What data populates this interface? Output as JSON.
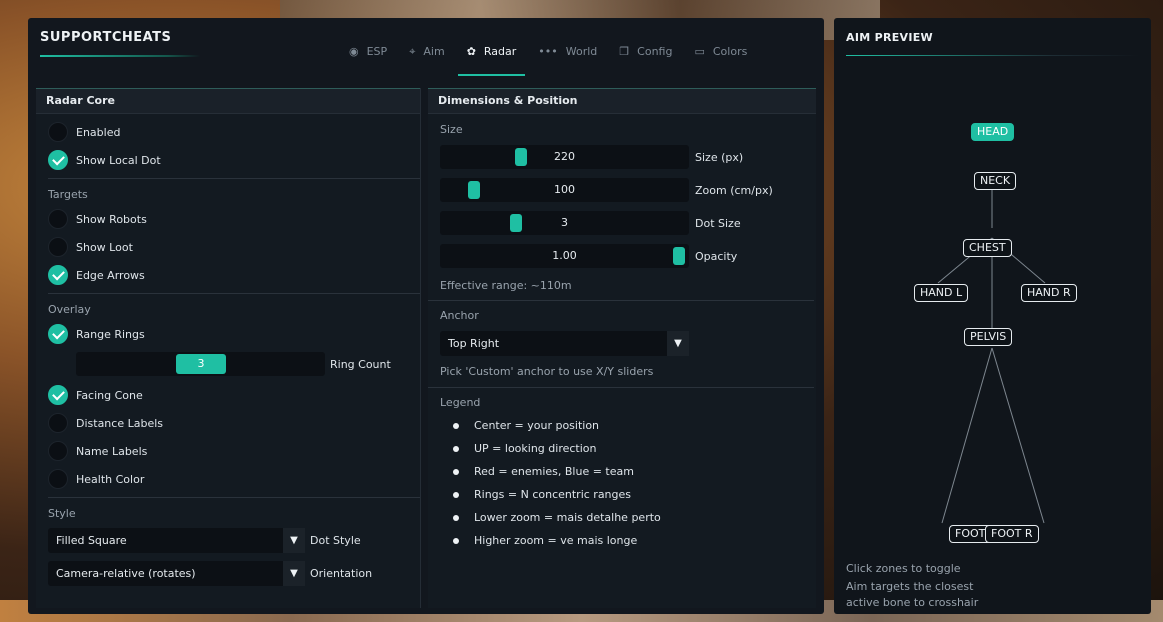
{
  "app": {
    "brand": "SUPPORTCHEATS"
  },
  "tabs": [
    {
      "icon": "eye-icon",
      "glyph": "◉",
      "label": "ESP",
      "active": false
    },
    {
      "icon": "crosshair-icon",
      "glyph": "⌖",
      "label": "Aim",
      "active": false
    },
    {
      "icon": "gear-icon",
      "glyph": "✿",
      "label": "Radar",
      "active": true
    },
    {
      "icon": "dots-icon",
      "glyph": "•••",
      "label": "World",
      "active": false
    },
    {
      "icon": "config-icon",
      "glyph": "❐",
      "label": "Config",
      "active": false
    },
    {
      "icon": "folder-icon",
      "glyph": "▭",
      "label": "Colors",
      "active": false
    }
  ],
  "left": {
    "title": "Radar Core",
    "enabled": {
      "label": "Enabled",
      "checked": false
    },
    "show_local_dot": {
      "label": "Show Local Dot",
      "checked": true
    },
    "targets_label": "Targets",
    "show_robots": {
      "label": "Show Robots",
      "checked": false
    },
    "show_loot": {
      "label": "Show Loot",
      "checked": false
    },
    "edge_arrows": {
      "label": "Edge Arrows",
      "checked": true
    },
    "overlay_label": "Overlay",
    "range_rings": {
      "label": "Range Rings",
      "checked": true
    },
    "ring_count": {
      "value": "3",
      "label": "Ring Count",
      "fraction": 0.5
    },
    "facing_cone": {
      "label": "Facing Cone",
      "checked": true
    },
    "distance_labels": {
      "label": "Distance Labels",
      "checked": false
    },
    "name_labels": {
      "label": "Name Labels",
      "checked": false
    },
    "health_color": {
      "label": "Health Color",
      "checked": false
    },
    "style_label": "Style",
    "dot_style": {
      "value": "Filled Square",
      "label": "Dot Style"
    },
    "orientation": {
      "value": "Camera-relative (rotates)",
      "label": "Orientation"
    }
  },
  "right": {
    "title": "Dimensions & Position",
    "size_label": "Size",
    "size_px": {
      "value": "220",
      "label": "Size (px)",
      "fraction": 0.32
    },
    "zoom": {
      "value": "100",
      "label": "Zoom (cm/px)",
      "fraction": 0.12
    },
    "dot_size": {
      "value": "3",
      "label": "Dot Size",
      "fraction": 0.3
    },
    "opacity": {
      "value": "1.00",
      "label": "Opacity",
      "fraction": 1.0
    },
    "effective_range": "Effective range: ~110m",
    "anchor_label": "Anchor",
    "anchor": {
      "value": "Top Right"
    },
    "anchor_hint": "Pick 'Custom' anchor to use X/Y sliders",
    "legend_label": "Legend",
    "legend": [
      "Center = your position",
      "UP = looking direction",
      "Red = enemies, Blue = team",
      "Rings = N concentric ranges",
      "Lower zoom = mais detalhe perto",
      "Higher zoom = ve mais longe"
    ]
  },
  "aim": {
    "title": "AIM PREVIEW",
    "bones": {
      "head": "HEAD",
      "neck": "NECK",
      "chest": "CHEST",
      "hand_l": "HAND L",
      "hand_r": "HAND R",
      "pelvis": "PELVIS",
      "foot_l": "FOOT L",
      "foot_r": "FOOT R"
    },
    "active_bone": "HEAD",
    "hint1": "Click zones to toggle",
    "hint2": "Aim targets the closest",
    "hint3": "active bone to crosshair"
  },
  "colors": {
    "accent": "#1fbfa3",
    "panel": "#131a21"
  }
}
